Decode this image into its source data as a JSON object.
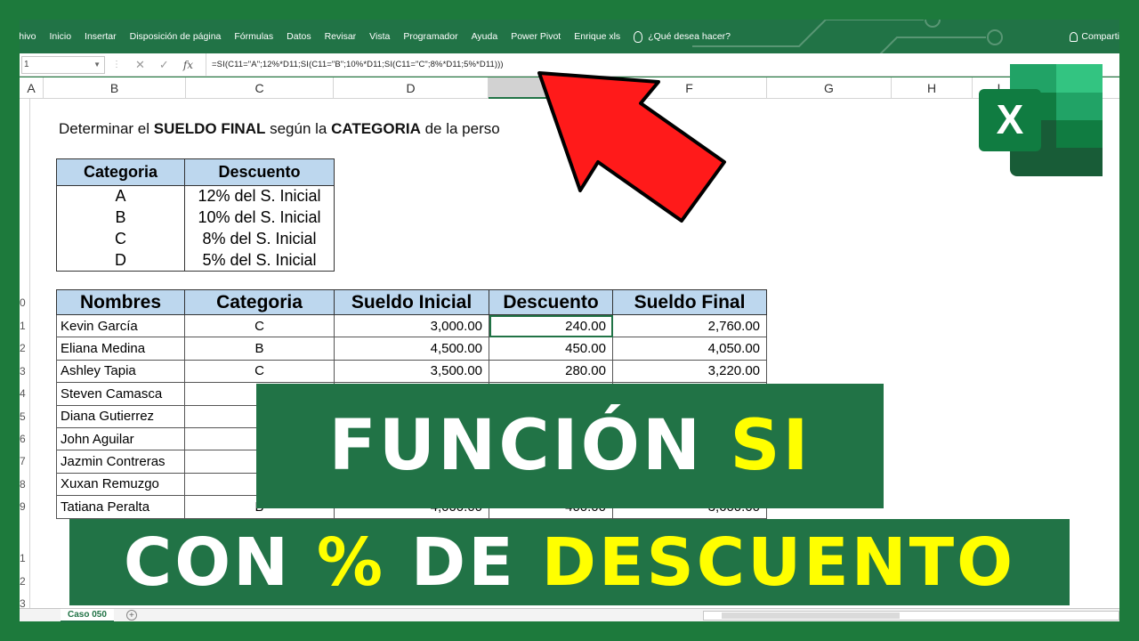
{
  "ribbon": {
    "tabs": [
      "chivo",
      "Inicio",
      "Insertar",
      "Disposición de página",
      "Fórmulas",
      "Datos",
      "Revisar",
      "Vista",
      "Programador",
      "Ayuda",
      "Power Pivot",
      "Enrique xls"
    ],
    "tell_me": "¿Qué desea hacer?",
    "share": "Comparti"
  },
  "formula_bar": {
    "namebox": "1",
    "formula": "=SI(C11=\"A\";12%*D11;SI(C11=\"B\";10%*D11;SI(C11=\"C\";8%*D11;5%*D11)))"
  },
  "columns": [
    "A",
    "B",
    "C",
    "D",
    "",
    "F",
    "G",
    "H",
    "I"
  ],
  "rows": [
    "",
    "",
    "",
    "",
    "",
    "",
    "",
    "",
    "0",
    "1",
    "2",
    "3",
    "4",
    "5",
    "6",
    "7",
    "8",
    "9",
    "",
    "1",
    "2",
    "3"
  ],
  "sheet": {
    "heading_pre": "Determinar el ",
    "heading_b1": "SUELDO FINAL",
    "heading_mid": " según la ",
    "heading_b2": "CATEGORIA",
    "heading_post": " de la perso"
  },
  "table1": {
    "headers": [
      "Categoria",
      "Descuento"
    ],
    "rows": [
      [
        "A",
        "12% del S. Inicial"
      ],
      [
        "B",
        "10% del S. Inicial"
      ],
      [
        "C",
        "8% del S. Inicial"
      ],
      [
        "D",
        "5% del S. Inicial"
      ]
    ]
  },
  "table2": {
    "headers": [
      "Nombres",
      "Categoria",
      "Sueldo Inicial",
      "Descuento",
      "Sueldo Final"
    ],
    "rows": [
      [
        "Kevin García",
        "C",
        "3,000.00",
        "240.00",
        "2,760.00"
      ],
      [
        "Eliana Medina",
        "B",
        "4,500.00",
        "450.00",
        "4,050.00"
      ],
      [
        "Ashley Tapia",
        "C",
        "3,500.00",
        "280.00",
        "3,220.00"
      ],
      [
        "Steven Camasca",
        "",
        "",
        "",
        ""
      ],
      [
        "Diana Gutierrez",
        "",
        "",
        "",
        ""
      ],
      [
        "John Aguilar",
        "",
        "",
        "",
        ""
      ],
      [
        "Jazmin Contreras",
        "",
        "",
        "",
        ""
      ],
      [
        "Xuxan Remuzgo",
        "",
        "",
        "",
        ""
      ],
      [
        "Tatiana Peralta",
        "B",
        "4,000.00",
        "400.00",
        "3,600.00"
      ]
    ]
  },
  "sheet_tab": "Caso 050",
  "banner": {
    "line1_white": "FUNCIÓN ",
    "line1_yellow": "SI",
    "line2_white1": "CON ",
    "line2_yellow1": "%",
    "line2_white2": " DE ",
    "line2_yellow2": "DESCUENTO"
  },
  "logo": {
    "letter": "X"
  },
  "colors": {
    "excel_green": "#217346",
    "header_blue": "#bdd7ee",
    "arrow_red": "#ff1a1a",
    "highlight_yellow": "#ffff00"
  }
}
